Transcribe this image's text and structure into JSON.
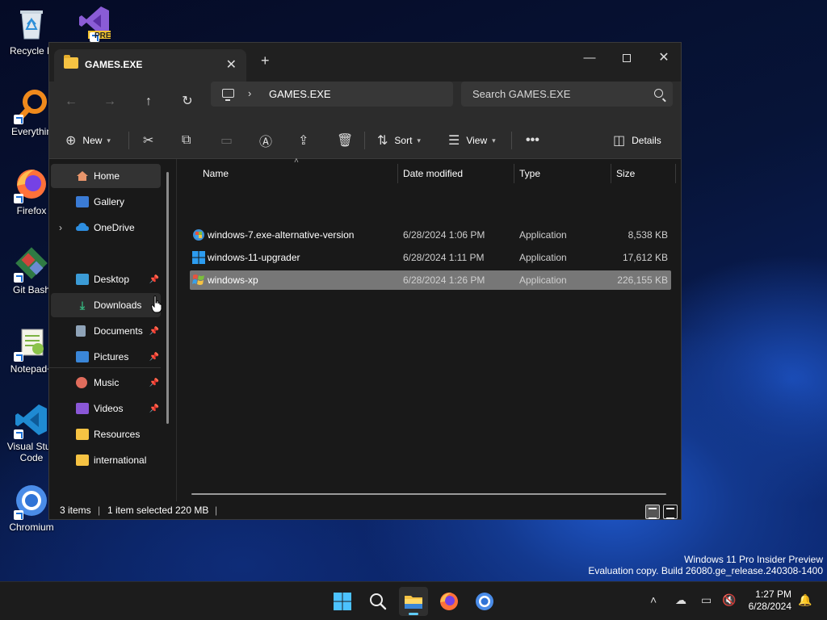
{
  "desktop": {
    "icons": [
      {
        "label": "Recycle B",
        "icon": "recycle-bin-icon"
      },
      {
        "label": "",
        "icon": "visual-studio-preview-icon",
        "badge": "PRE"
      },
      {
        "label": "Everythin",
        "icon": "everything-search-icon"
      },
      {
        "label": "Firefox",
        "icon": "firefox-icon"
      },
      {
        "label": "Git Bash",
        "icon": "git-bash-icon"
      },
      {
        "label": "Notepad+",
        "icon": "notepad-plus-plus-icon"
      },
      {
        "label": "Visual Stud",
        "label2": "Code",
        "icon": "vscode-icon"
      },
      {
        "label": "Chromium",
        "icon": "chromium-icon"
      }
    ]
  },
  "window": {
    "tab_title": "GAMES.EXE",
    "address_path": "GAMES.EXE",
    "search_placeholder": "Search GAMES.EXE",
    "commands": {
      "new": "New",
      "sort": "Sort",
      "view": "View",
      "details": "Details"
    },
    "nav": {
      "home": "Home",
      "gallery": "Gallery",
      "onedrive": "OneDrive",
      "desktop": "Desktop",
      "downloads": "Downloads",
      "documents": "Documents",
      "pictures": "Pictures",
      "music": "Music",
      "videos": "Videos",
      "resources": "Resources",
      "international": "international"
    },
    "columns": {
      "name": "Name",
      "date": "Date modified",
      "type": "Type",
      "size": "Size"
    },
    "files": [
      {
        "name": "windows-7.exe-alternative-version",
        "date": "6/28/2024 1:06 PM",
        "type": "Application",
        "size": "8,538 KB",
        "selected": false
      },
      {
        "name": "windows-11-upgrader",
        "date": "6/28/2024 1:11 PM",
        "type": "Application",
        "size": "17,612 KB",
        "selected": false
      },
      {
        "name": "windows-xp",
        "date": "6/28/2024 1:26 PM",
        "type": "Application",
        "size": "226,155 KB",
        "selected": true
      }
    ],
    "status": {
      "item_count": "3 items",
      "selection": "1 item selected",
      "selection_size": "220 MB"
    }
  },
  "watermark": {
    "line1": "Windows 11 Pro Insider Preview",
    "line2": "Evaluation copy. Build 26080.ge_release.240308-1400"
  },
  "taskbar": {
    "time": "1:27 PM",
    "date": "6/28/2024"
  },
  "colors": {
    "accent": "#60cdff",
    "folder": "#f6c343",
    "selection": "#777777"
  }
}
